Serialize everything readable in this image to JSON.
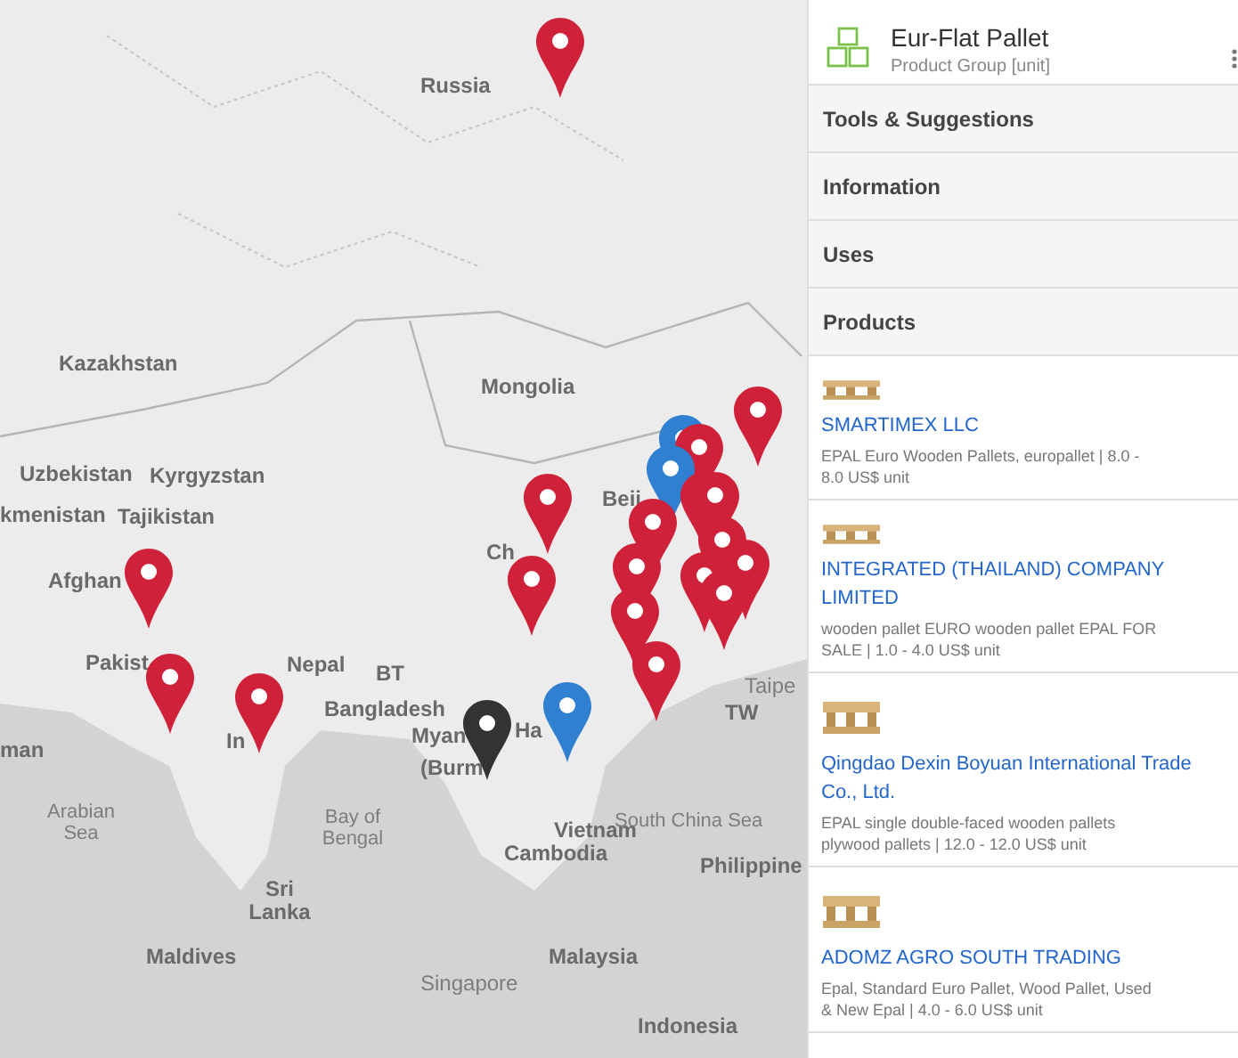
{
  "map": {
    "labels": [
      {
        "text": "Russia",
        "kind": "country"
      },
      {
        "text": "Kazakhstan",
        "kind": "country"
      },
      {
        "text": "Mongolia",
        "kind": "country"
      },
      {
        "text": "Uzbekistan",
        "kind": "country"
      },
      {
        "text": "Kyrgyzstan",
        "kind": "country"
      },
      {
        "text": "kmenistan",
        "kind": "country"
      },
      {
        "text": "Tajikistan",
        "kind": "country"
      },
      {
        "text": "Beij",
        "kind": "country"
      },
      {
        "text": "Ch",
        "kind": "country"
      },
      {
        "text": "Afghan",
        "kind": "country"
      },
      {
        "text": "Pakist",
        "kind": "country"
      },
      {
        "text": "Nepal",
        "kind": "country"
      },
      {
        "text": "BT",
        "kind": "country"
      },
      {
        "text": "Bangladesh",
        "kind": "country"
      },
      {
        "text": "In",
        "kind": "country"
      },
      {
        "text": "Myan",
        "kind": "country"
      },
      {
        "text": "(Burm",
        "kind": "country"
      },
      {
        "text": "Ha",
        "kind": "country"
      },
      {
        "text": "man",
        "kind": "country"
      },
      {
        "text": "Taipe",
        "kind": "city"
      },
      {
        "text": "TW",
        "kind": "country"
      },
      {
        "text": "Arabian Sea",
        "kind": "sea"
      },
      {
        "text": "Bay of Bengal",
        "kind": "sea"
      },
      {
        "text": "Vietnam",
        "kind": "country"
      },
      {
        "text": "Cambodia",
        "kind": "country"
      },
      {
        "text": "South China Sea",
        "kind": "sea"
      },
      {
        "text": "Philippine",
        "kind": "country"
      },
      {
        "text": "Sri Lanka",
        "kind": "country"
      },
      {
        "text": "Maldives",
        "kind": "country"
      },
      {
        "text": "Malaysia",
        "kind": "country"
      },
      {
        "text": "Singapore",
        "kind": "city"
      },
      {
        "text": "Indonesia",
        "kind": "country"
      }
    ],
    "pins": [
      {
        "color": "#d0213a"
      },
      {
        "color": "#d0213a"
      },
      {
        "color": "#2f80d0"
      },
      {
        "color": "#d0213a"
      },
      {
        "color": "#2f80d0"
      },
      {
        "color": "#d0213a"
      },
      {
        "color": "#d0213a"
      },
      {
        "color": "#d0213a"
      },
      {
        "color": "#d0213a"
      },
      {
        "color": "#d0213a"
      },
      {
        "color": "#d0213a"
      },
      {
        "color": "#d0213a"
      },
      {
        "color": "#d0213a"
      },
      {
        "color": "#d0213a"
      },
      {
        "color": "#d0213a"
      },
      {
        "color": "#d0213a"
      },
      {
        "color": "#d0213a"
      },
      {
        "color": "#d0213a"
      },
      {
        "color": "#d0213a"
      },
      {
        "color": "#d0213a"
      },
      {
        "color": "#333333"
      },
      {
        "color": "#2f80d0"
      }
    ]
  },
  "panel": {
    "title": "Eur-Flat Pallet",
    "subtitle": "Product Group [unit]",
    "sections": [
      "Tools & Suggestions",
      "Information",
      "Uses",
      "Products"
    ],
    "products": [
      {
        "name": "SMARTIMEX LLC",
        "description": "EPAL Euro Wooden Pallets, europallet | 8.0 - 8.0 US$ unit"
      },
      {
        "name": "INTEGRATED (THAILAND) COMPANY LIMITED",
        "description": "wooden pallet EURO wooden pallet EPAL FOR SALE | 1.0 - 4.0 US$ unit"
      },
      {
        "name": "Qingdao Dexin Boyuan International Trade Co., Ltd.",
        "description": "EPAL single double-faced wooden pallets plywood pallets | 12.0 - 12.0 US$ unit"
      },
      {
        "name": "ADOMZ AGRO SOUTH TRADING",
        "description": "Epal, Standard Euro Pallet, Wood Pallet, Used & New Epal | 4.0 - 6.0 US$ unit"
      }
    ]
  }
}
